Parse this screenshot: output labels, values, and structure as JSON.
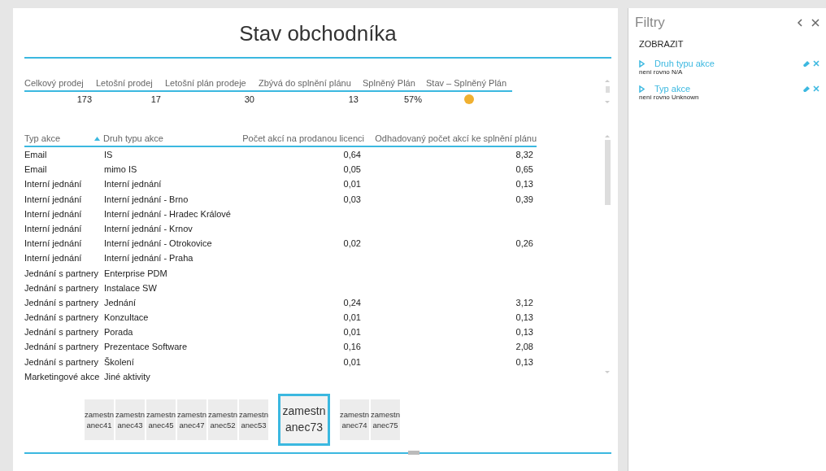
{
  "report": {
    "title": "Stav obchodníka",
    "summary": {
      "columns": [
        "Celkový prodej",
        "Letošní prodej",
        "Letošní plán prodeje",
        "Zbývá do splnění plánu",
        "Splněný Plán",
        "Stav – Splněný Plán"
      ],
      "values": [
        "173",
        "17",
        "30",
        "13",
        "57%"
      ],
      "indicator": {
        "color": "#f0b030"
      }
    },
    "details": {
      "columns": [
        {
          "label": "Typ akce",
          "sorted_ascending": false
        },
        {
          "label": "Druh typu akce",
          "sorted_ascending": true
        },
        {
          "label": "Počet akcí na prodanou licenci",
          "sorted_ascending": false
        },
        {
          "label": "Odhadovaný počet akcí ke splnění plánu",
          "sorted_ascending": false
        }
      ],
      "rows": [
        [
          "Email",
          "IS",
          "0,64",
          "8,32"
        ],
        [
          "Email",
          "mimo IS",
          "0,05",
          "0,65"
        ],
        [
          "Interní jednání",
          "Interní jednání",
          "0,01",
          "0,13"
        ],
        [
          "Interní jednání",
          "Interní jednání - Brno",
          "0,03",
          "0,39"
        ],
        [
          "Interní jednání",
          "Interní jednání - Hradec Králové",
          "",
          ""
        ],
        [
          "Interní jednání",
          "Interní jednání - Krnov",
          "",
          ""
        ],
        [
          "Interní jednání",
          "Interní jednání - Otrokovice",
          "0,02",
          "0,26"
        ],
        [
          "Interní jednání",
          "Interní jednání - Praha",
          "",
          ""
        ],
        [
          "Jednání s partnery",
          "Enterprise PDM",
          "",
          ""
        ],
        [
          "Jednání s partnery",
          "Instalace SW",
          "",
          ""
        ],
        [
          "Jednání s partnery",
          "Jednání",
          "0,24",
          "3,12"
        ],
        [
          "Jednání s partnery",
          "Konzultace",
          "0,01",
          "0,13"
        ],
        [
          "Jednání s partnery",
          "Porada",
          "0,01",
          "0,13"
        ],
        [
          "Jednání s partnery",
          "Prezentace Software",
          "0,16",
          "2,08"
        ],
        [
          "Jednání s partnery",
          "Školení",
          "0,01",
          "0,13"
        ],
        [
          "Marketingové akce",
          "Jiné aktivity",
          "",
          ""
        ]
      ]
    },
    "tiles": [
      {
        "line1": "zamestn",
        "line2": "anec41",
        "selected": false
      },
      {
        "line1": "zamestn",
        "line2": "anec43",
        "selected": false
      },
      {
        "line1": "zamestn",
        "line2": "anec45",
        "selected": false
      },
      {
        "line1": "zamestn",
        "line2": "anec47",
        "selected": false
      },
      {
        "line1": "zamestn",
        "line2": "anec52",
        "selected": false
      },
      {
        "line1": "zamestn",
        "line2": "anec53",
        "selected": false
      },
      {
        "line1": "zamestn",
        "line2": "anec73",
        "selected": true
      },
      {
        "line1": "zamestn",
        "line2": "anec74",
        "selected": false
      },
      {
        "line1": "zamestn",
        "line2": "anec75",
        "selected": false
      }
    ]
  },
  "filters": {
    "title": "Filtry",
    "section": "ZOBRAZIT",
    "items": [
      {
        "name": "Druh typu akce",
        "condition": "není rovno N/A"
      },
      {
        "name": "Typ akce",
        "condition": "není rovno Unknown"
      }
    ]
  }
}
